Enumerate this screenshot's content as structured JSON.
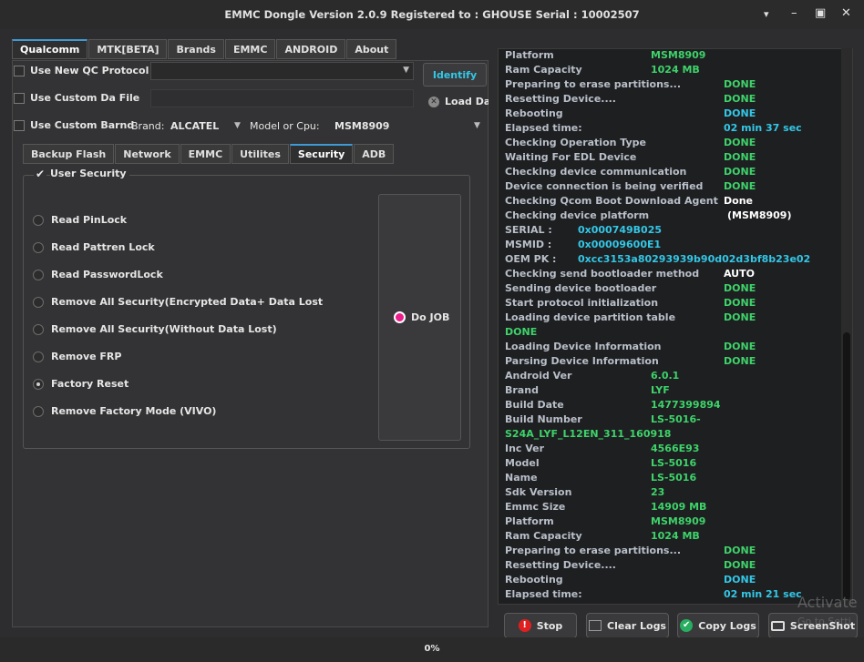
{
  "window": {
    "title": "EMMC Dongle Version 2.0.9 Registered to : GHOUSE   Serial : 10002507",
    "minimize_glyph": "▾",
    "min_glyph": "–",
    "max_glyph": "▣",
    "close_glyph": "✕"
  },
  "main_tabs": [
    "Qualcomm",
    "MTK[BETA]",
    "Brands",
    "EMMC",
    "ANDROID",
    "About"
  ],
  "options": {
    "qc_protocol_label": "Use New QC Protocol",
    "custom_da_label": "Use Custom Da File",
    "custom_brand_label": "Use Custom Barnd",
    "brand_label": "Brand:",
    "brand_value": "ALCATEL",
    "model_label": "Model or Cpu:",
    "model_value": "MSM8909",
    "identify_label": "Identify",
    "load_da_label": "Load Da"
  },
  "sub_tabs": [
    "Backup  Flash",
    "Network",
    "EMMC",
    "Utilites",
    "Security",
    "ADB"
  ],
  "security": {
    "group_title": "User Security",
    "options": [
      "Read PinLock",
      "Read Pattren Lock",
      "Read PasswordLock",
      "Remove All Security(Encrypted Data+ Data Lost",
      "Remove All Security(Without Data Lost)",
      "Remove FRP",
      "Factory Reset",
      "Remove Factory Mode (VIVO)"
    ],
    "selected": "Factory Reset",
    "do_job_label": "Do JOB"
  },
  "log": [
    {
      "k": "Platform",
      "v": "MSM8909",
      "c": "green",
      "col": 2
    },
    {
      "k": "Ram Capacity",
      "v": "1024 MB",
      "c": "green",
      "col": 2
    },
    {
      "k": "Preparing to erase partitions...",
      "v": "DONE",
      "c": "green",
      "col": 3
    },
    {
      "k": "Resetting Device....",
      "v": "DONE",
      "c": "green",
      "col": 3
    },
    {
      "k": "Rebooting",
      "v": "DONE",
      "c": "cyan",
      "col": 3
    },
    {
      "k": "Elapsed time:",
      "v": "02 min  37 sec",
      "c": "cyan",
      "col": 3
    },
    {
      "k": "Checking Operation Type",
      "v": "DONE",
      "c": "green",
      "col": 3
    },
    {
      "k": "Waiting For EDL Device",
      "v": "DONE",
      "c": "green",
      "col": 3
    },
    {
      "k": "Checking device communication",
      "v": "DONE",
      "c": "green",
      "col": 3
    },
    {
      "k": "Device connection is being verified",
      "v": "DONE",
      "c": "green",
      "col": 3
    },
    {
      "k": "Checking Qcom Boot Download Agent",
      "v": "Done",
      "c": "white",
      "col": 3
    },
    {
      "k": "Checking device platform",
      "v": "(MSM8909)",
      "c": "white",
      "col": 4
    },
    {
      "k": "SERIAL :",
      "v": "0x000749B025",
      "c": "cyan",
      "col": 1
    },
    {
      "k": "MSMID  :",
      "v": "0x00009600E1",
      "c": "cyan",
      "col": 1
    },
    {
      "k": "OEM PK :",
      "v": "0xcc3153a80293939b90d02d3bf8b23e02",
      "c": "cyan",
      "col": 1
    },
    {
      "k": "Checking send bootloader method",
      "v": "AUTO",
      "c": "white",
      "col": 3
    },
    {
      "k": "Sending device bootloader",
      "v": "DONE",
      "c": "green",
      "col": 3
    },
    {
      "k": "Start protocol initialization",
      "v": "DONE",
      "c": "green",
      "col": 3
    },
    {
      "k": "Loading device partition table",
      "v": "DONE",
      "c": "green",
      "col": 3
    },
    {
      "k": "",
      "v": "DONE",
      "c": "green",
      "col": 0
    },
    {
      "k": "Loading Device Information",
      "v": "DONE",
      "c": "green",
      "col": 3
    },
    {
      "k": "Parsing Device Information",
      "v": "DONE",
      "c": "green",
      "col": 3
    },
    {
      "k": "Android Ver",
      "v": "6.0.1",
      "c": "green",
      "col": 2
    },
    {
      "k": "Brand",
      "v": "LYF",
      "c": "green",
      "col": 2
    },
    {
      "k": "Build Date",
      "v": "1477399894",
      "c": "green",
      "col": 2
    },
    {
      "k": "Build Number",
      "v": "LS-5016-",
      "c": "green",
      "col": 2
    },
    {
      "k": "",
      "v": "S24A_LYF_L12EN_311_160918",
      "c": "green",
      "col": 0
    },
    {
      "k": "Inc Ver",
      "v": "4566E93",
      "c": "green",
      "col": 2
    },
    {
      "k": "Model",
      "v": "LS-5016",
      "c": "green",
      "col": 2
    },
    {
      "k": "Name",
      "v": "LS-5016",
      "c": "green",
      "col": 2
    },
    {
      "k": "Sdk Version",
      "v": "23",
      "c": "green",
      "col": 2
    },
    {
      "k": "Emmc Size",
      "v": "14909 MB",
      "c": "green",
      "col": 2
    },
    {
      "k": "Platform",
      "v": "MSM8909",
      "c": "green",
      "col": 2
    },
    {
      "k": "Ram Capacity",
      "v": "1024 MB",
      "c": "green",
      "col": 2
    },
    {
      "k": "Preparing to erase partitions...",
      "v": "DONE",
      "c": "green",
      "col": 3
    },
    {
      "k": "Resetting Device....",
      "v": "DONE",
      "c": "green",
      "col": 3
    },
    {
      "k": "Rebooting",
      "v": "DONE",
      "c": "cyan",
      "col": 3
    },
    {
      "k": "Elapsed time:",
      "v": "02 min  21 sec",
      "c": "cyan",
      "col": 3
    }
  ],
  "buttons": {
    "stop": "Stop",
    "clear_logs": "Clear Logs",
    "copy_logs": "Copy Logs",
    "screenshot": "ScreenShot"
  },
  "progress": {
    "value": 0,
    "label": "0%"
  },
  "watermark": {
    "line1": "Activate",
    "line2": "Go to Setti"
  },
  "colors": {
    "accent": "#3d9ad6",
    "done_green": "#3ed36a",
    "cyan": "#33c7e6",
    "stop_red": "#e02020",
    "copy_green": "#27ae60"
  }
}
